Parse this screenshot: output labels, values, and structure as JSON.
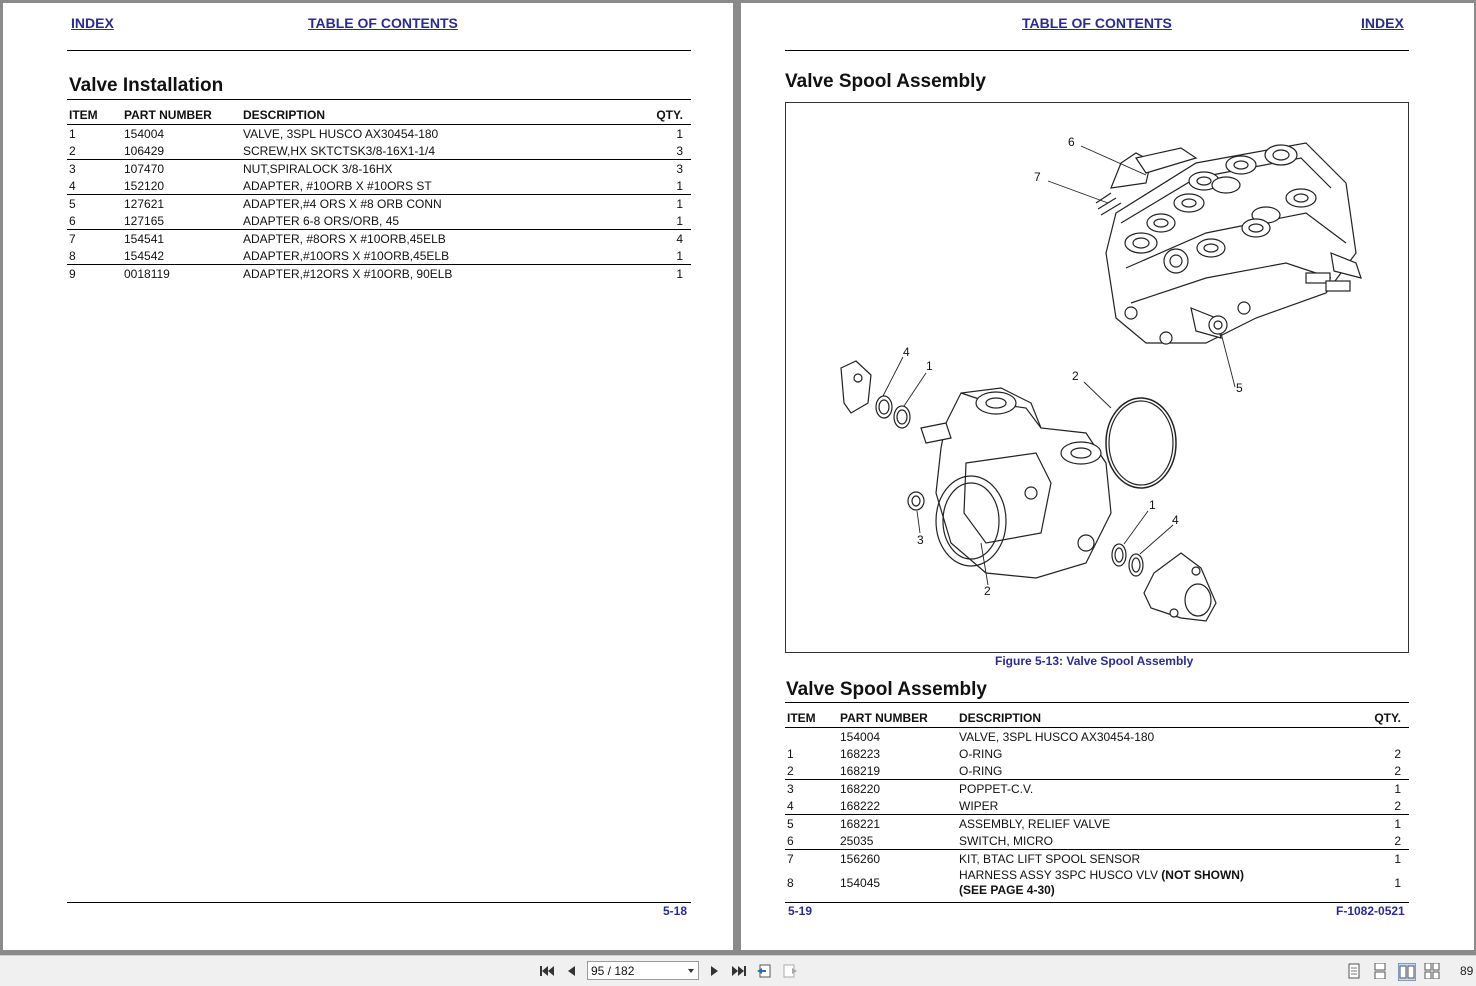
{
  "left_page": {
    "header": {
      "index_link": "INDEX",
      "toc_link": "TABLE OF CONTENTS"
    },
    "section_title": "Valve Installation",
    "table": {
      "columns": [
        "ITEM",
        "PART NUMBER",
        "DESCRIPTION",
        "QTY."
      ],
      "rows": [
        {
          "item": "1",
          "part": "154004",
          "desc": "VALVE, 3SPL HUSCO AX30454-180",
          "qty": "1"
        },
        {
          "item": "2",
          "part": "106429",
          "desc": "SCREW,HX SKTCTSK3/8-16X1-1/4",
          "qty": "3"
        },
        {
          "item": "3",
          "part": "107470",
          "desc": "NUT,SPIRALOCK 3/8-16HX",
          "qty": "3"
        },
        {
          "item": "4",
          "part": "152120",
          "desc": "ADAPTER, #10ORB X #10ORS ST",
          "qty": "1"
        },
        {
          "item": "5",
          "part": "127621",
          "desc": "ADAPTER,#4 ORS X #8 ORB  CONN",
          "qty": "1"
        },
        {
          "item": "6",
          "part": "127165",
          "desc": "ADAPTER 6-8 ORS/ORB, 45",
          "qty": "1"
        },
        {
          "item": "7",
          "part": "154541",
          "desc": "ADAPTER, #8ORS X #10ORB,45ELB",
          "qty": "4"
        },
        {
          "item": "8",
          "part": "154542",
          "desc": "ADAPTER,#10ORS X #10ORB,45ELB",
          "qty": "1"
        },
        {
          "item": "9",
          "part": "0018119",
          "desc": "ADAPTER,#12ORS X #10ORB, 90ELB",
          "qty": "1"
        }
      ]
    },
    "page_number": "5-18"
  },
  "right_page": {
    "header": {
      "toc_link": "TABLE OF CONTENTS",
      "index_link": "INDEX"
    },
    "section_title": "Valve Spool Assembly",
    "figure": {
      "caption": "Figure 5-13:  Valve Spool Assembly",
      "callouts": [
        "6",
        "7",
        "4",
        "1",
        "2",
        "5",
        "1",
        "4",
        "3",
        "2"
      ]
    },
    "table_title": "Valve Spool Assembly",
    "table": {
      "columns": [
        "ITEM",
        "PART NUMBER",
        "DESCRIPTION",
        "QTY."
      ],
      "rows": [
        {
          "item": "",
          "part": "154004",
          "desc": "VALVE, 3SPL HUSCO AX30454-180",
          "qty": ""
        },
        {
          "item": "1",
          "part": "168223",
          "desc": "O-RING",
          "qty": "2"
        },
        {
          "item": "2",
          "part": "168219",
          "desc": "O-RING",
          "qty": "2"
        },
        {
          "item": "3",
          "part": "168220",
          "desc": "POPPET-C.V.",
          "qty": "1"
        },
        {
          "item": "4",
          "part": "168222",
          "desc": "WIPER",
          "qty": "2"
        },
        {
          "item": "5",
          "part": "168221",
          "desc": "ASSEMBLY, RELIEF VALVE",
          "qty": "1"
        },
        {
          "item": "6",
          "part": "25035",
          "desc": "SWITCH, MICRO",
          "qty": "2"
        },
        {
          "item": "7",
          "part": "156260",
          "desc": "KIT, BTAC LIFT SPOOL SENSOR",
          "qty": "1"
        },
        {
          "item": "8",
          "part": "154045",
          "desc": "HARNESS ASSY 3SPC HUSCO VLV ",
          "desc_bold": "(NOT SHOWN)",
          "desc_line2": "(SEE PAGE 4-30)",
          "qty": "1"
        }
      ]
    },
    "page_number": "5-19",
    "doc_number": "F-1082-0521"
  },
  "viewer": {
    "page_field": "95 / 182",
    "zoom": "89",
    "icons": [
      "first-page-icon",
      "previous-page-icon",
      "next-page-icon",
      "last-page-icon",
      "previous-view-icon",
      "next-view-icon",
      "single-page-view-icon",
      "continuous-view-icon",
      "two-page-view-icon",
      "continuous-two-page-view-icon"
    ]
  }
}
